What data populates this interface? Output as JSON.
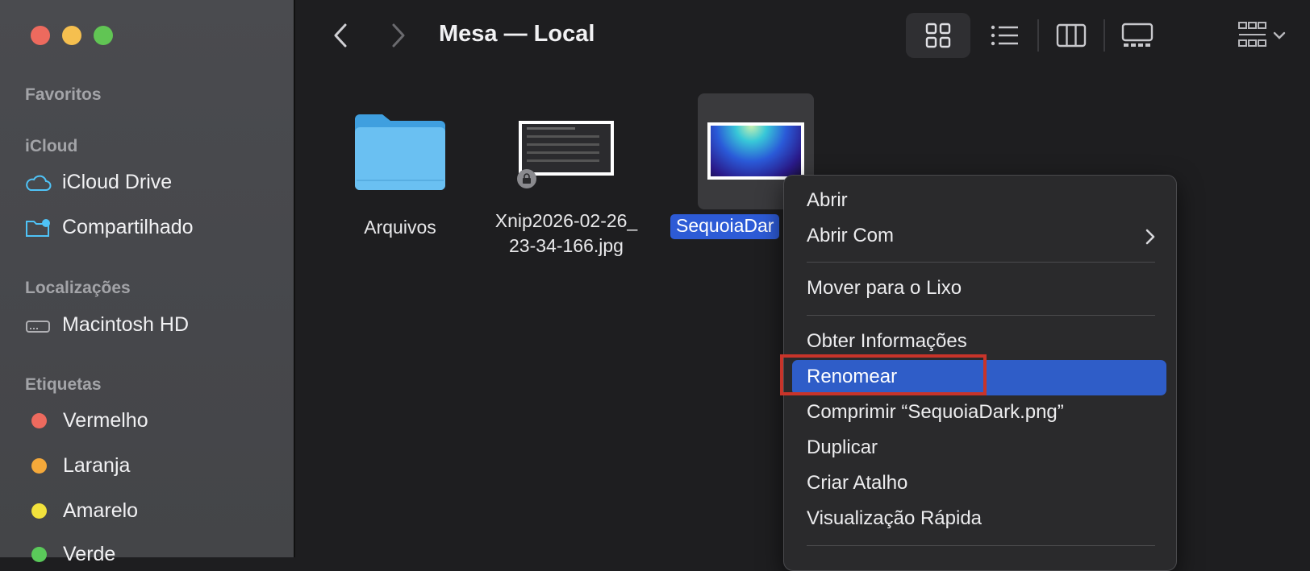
{
  "window": {
    "title": "Mesa — Local"
  },
  "sidebar": {
    "sections": {
      "favorites": "Favoritos",
      "icloud": "iCloud",
      "locations": "Localizações",
      "tags": "Etiquetas"
    },
    "icloud_items": [
      {
        "label": "iCloud Drive",
        "icon": "cloud-icon"
      },
      {
        "label": "Compartilhado",
        "icon": "shared-folder-icon"
      }
    ],
    "location_items": [
      {
        "label": "Macintosh HD",
        "icon": "disk-icon"
      }
    ],
    "tag_items": [
      {
        "label": "Vermelho",
        "color": "#ed6a5e"
      },
      {
        "label": "Laranja",
        "color": "#f5a93a"
      },
      {
        "label": "Amarelo",
        "color": "#f2e23c"
      },
      {
        "label": "Verde",
        "color": "#5ac95a"
      }
    ]
  },
  "files": [
    {
      "name": "Arquivos",
      "type": "folder"
    },
    {
      "name_line1": "Xnip2026-02-26_",
      "name_line2": "23-34-166.jpg",
      "type": "image",
      "locked": true
    },
    {
      "name": "SequoiaDar",
      "type": "image",
      "selected": true
    }
  ],
  "context_menu": {
    "items": [
      {
        "label": "Abrir"
      },
      {
        "label": "Abrir Com",
        "submenu": true
      },
      {
        "label": "Mover para o Lixo"
      },
      {
        "label": "Obter Informações"
      },
      {
        "label": "Renomear",
        "highlighted": true
      },
      {
        "label": "Comprimir “SequoiaDark.png”"
      },
      {
        "label": "Duplicar"
      },
      {
        "label": "Criar Atalho"
      },
      {
        "label": "Visualização Rápida"
      }
    ]
  },
  "colors": {
    "accent": "#2f5dc8",
    "highlight_box": "#c8342a"
  }
}
